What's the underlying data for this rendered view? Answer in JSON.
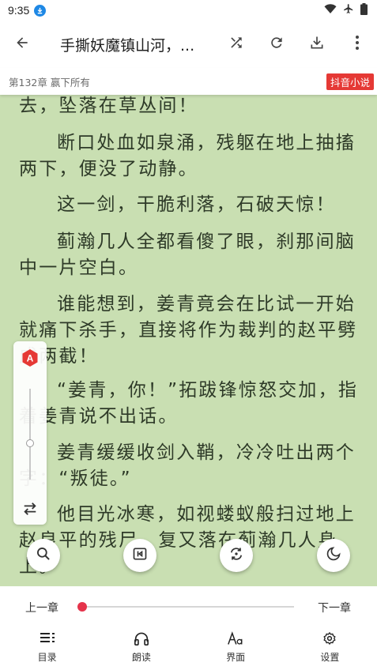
{
  "status_bar": {
    "time": "9:35",
    "icons": [
      "download-badge-icon",
      "wifi-icon",
      "airplane-mode-icon",
      "battery-icon"
    ]
  },
  "app_bar": {
    "title": "手撕妖魔镇山河，...",
    "icons": [
      "back-arrow-icon",
      "shuffle-icon",
      "refresh-icon",
      "download-icon",
      "more-vert-icon"
    ]
  },
  "chapter_bar": {
    "chapter_title": "第132章 赢下所有",
    "source_tag": "抖音小说",
    "tag_color": "#e53935"
  },
  "reader": {
    "background_color": "#c9dfb2",
    "paragraphs": [
      "去，坠落在草丛间！",
      "断口处血如泉涌，残躯在地上抽搐两下，便没了动静。",
      "这一剑，干脆利落，石破天惊！",
      "蓟瀚几人全都看傻了眼，刹那间脑中一片空白。",
      "谁能想到，姜青竟会在比试一开始就痛下杀手，直接将作为裁判的赵平劈成两截！",
      "“姜青，你！”拓跋锋惊怒交加，指着姜青说不出话。",
      "姜青缓缓收剑入鞘，冷冷吐出两个字：“叛徒。”",
      "他目光冰寒，如视蝼蚁般扫过地上赵良平的残尸，复又落在蓟瀚几人身上。"
    ]
  },
  "side_panel": {
    "auto_badge": "A",
    "accent_color": "#e53935",
    "icons": [
      "auto-page-icon",
      "swap-orientation-icon"
    ]
  },
  "fab_buttons": [
    "search-icon",
    "auto-read-icon",
    "replace-icon",
    "night-mode-icon"
  ],
  "bottom_bar": {
    "prev_chapter": "上一章",
    "next_chapter": "下一章",
    "progress_fraction": 0,
    "progress_color": "#e5334b",
    "nav": [
      {
        "label": "目录",
        "icon": "toc-icon"
      },
      {
        "label": "朗读",
        "icon": "headphones-icon"
      },
      {
        "label": "界面",
        "icon": "font-style-icon"
      },
      {
        "label": "设置",
        "icon": "settings-gear-icon"
      }
    ]
  }
}
